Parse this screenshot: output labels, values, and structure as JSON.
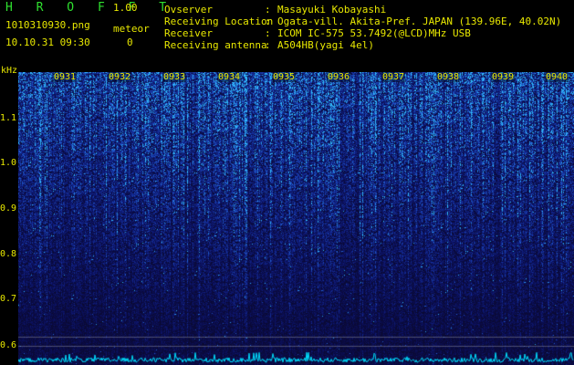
{
  "app": {
    "title": "H R O F F T",
    "version": "1.00",
    "filename": "1010310930.png",
    "datetime": "10.10.31 09:30",
    "meteor_label": "meteor",
    "meteor_count": "0"
  },
  "info": [
    {
      "key": "Ovserver",
      "sep": ":",
      "value": "Masayuki Kobayashi"
    },
    {
      "key": "Receiving Location",
      "sep": ":",
      "value": "Ogata-vill. Akita-Pref. JAPAN (139.96E, 40.02N)"
    },
    {
      "key": "Receiver",
      "sep": ":",
      "value": "ICOM IC-575 53.7492(@LCD)MHz USB"
    },
    {
      "key": "Receiving antenna",
      "sep": ":",
      "value": "A504HB(yagi 4el)"
    }
  ],
  "axis": {
    "unit": "kHz",
    "y_ticks": [
      "1.1",
      "1.0",
      "0.9",
      "0.8",
      "0.7",
      "0.6"
    ],
    "x_ticks": [
      "0931",
      "0932",
      "0933",
      "0934",
      "0935",
      "0936",
      "0937",
      "0938",
      "0939",
      "0940"
    ]
  },
  "colors": {
    "label": "#e8e800",
    "title": "#2fe02f",
    "background": "#000000",
    "spectrum_low": "#0a0a3a",
    "spectrum_high": "#3aa0ff",
    "trace": "#00e0ff"
  }
}
